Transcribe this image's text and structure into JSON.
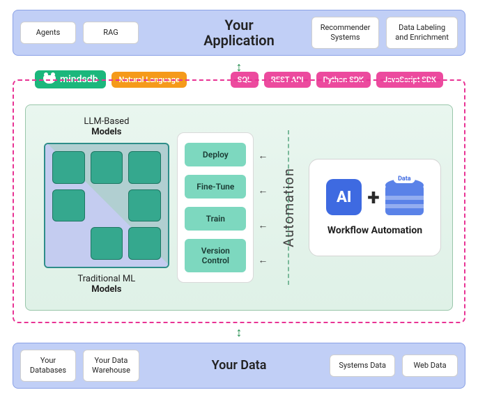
{
  "top_band": {
    "title": "Your\nApplication",
    "left_chips": [
      "Agents",
      "RAG"
    ],
    "right_chips": [
      "Recommender\nSystems",
      "Data Labeling\nand Enrichment"
    ]
  },
  "bottom_band": {
    "title": "Your Data",
    "left_chips": [
      "Your\nDatabases",
      "Your Data\nWarehouse"
    ],
    "right_chips": [
      "Systems Data",
      "Web Data"
    ]
  },
  "brand": {
    "name": "mindsdb"
  },
  "interfaces": {
    "highlight": "Natural Language",
    "pills": [
      "SQL",
      "REST API",
      "Python SDK",
      "JavaScript SDK"
    ]
  },
  "models": {
    "heading_prefix": "LLM-Based",
    "heading_bold": "Models",
    "sub_prefix": "Traditional ML",
    "sub_bold": "Models"
  },
  "ops": [
    "Deploy",
    "Fine-Tune",
    "Train",
    "Version Control"
  ],
  "automation_label": "Automation",
  "workflow": {
    "ai_label": "AI",
    "plus": "+",
    "data_label": "Data",
    "title": "Workflow Automation"
  },
  "arrows": {
    "vertical": "↕",
    "left": "←"
  }
}
